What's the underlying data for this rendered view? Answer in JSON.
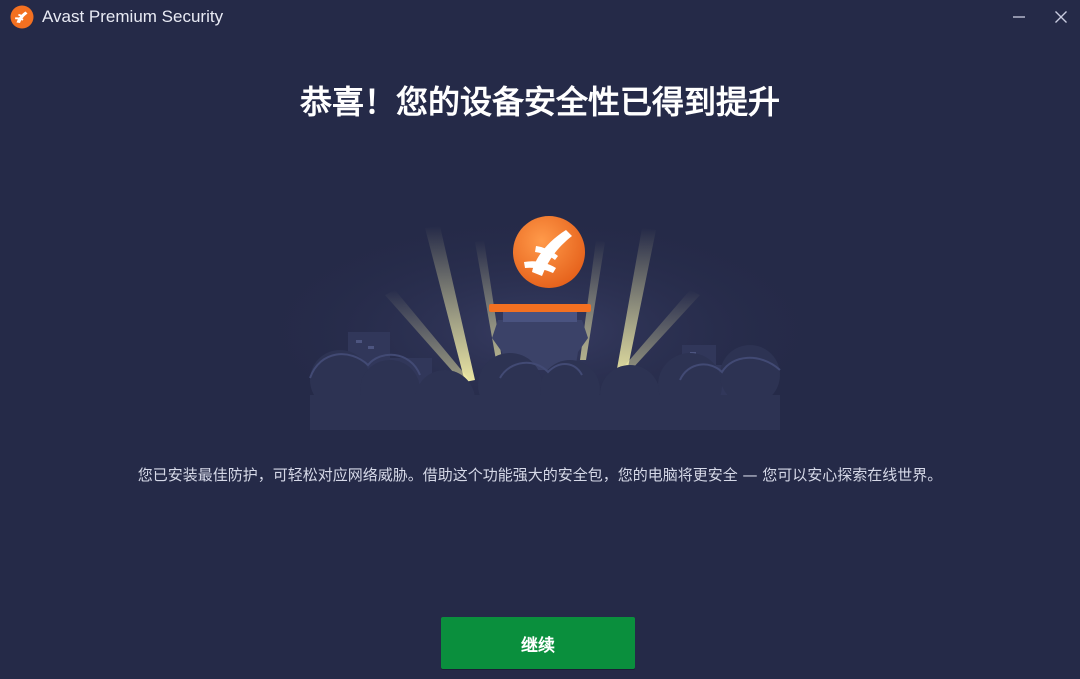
{
  "window": {
    "title": "Avast Premium Security",
    "minimize_icon": "minimize-icon",
    "close_icon": "close-icon"
  },
  "main": {
    "headline": "恭喜！您的设备安全性已得到提升",
    "description": "您已安装最佳防护，可轻松对应网络威胁。借助这个功能强大的安全包，您的电脑将更安全 — 您可以安心探索在线世界。",
    "continue_label": "继续"
  },
  "colors": {
    "background": "#252a48",
    "accent_orange": "#f37021",
    "button_green": "#0a8f3d",
    "spotlight": "#f5f0a8"
  },
  "icons": {
    "app_logo": "avast-logo-icon",
    "illustration": "avast-orb-pedestal-illustration"
  }
}
